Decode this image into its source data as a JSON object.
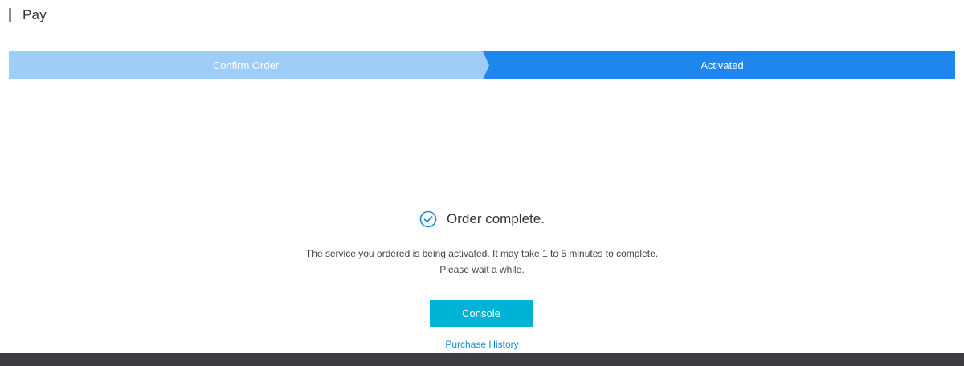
{
  "header": {
    "title": "Pay"
  },
  "steps": [
    {
      "label": "Confirm Order",
      "state": "completed",
      "color": "#9fcdf9"
    },
    {
      "label": "Activated",
      "state": "current",
      "color": "#1e87ee"
    }
  ],
  "result": {
    "title": "Order complete.",
    "icon": "check-circle-icon",
    "icon_color": "#1a88d6",
    "message_line1": "The service you ordered is being activated. It may take 1 to 5 minutes to complete.",
    "message_line2": "Please wait a while."
  },
  "actions": {
    "console_label": "Console",
    "console_color": "#00b3d6",
    "history_label": "Purchase History",
    "history_color": "#1a88d6"
  },
  "footer": {
    "color": "#3b3d41"
  }
}
